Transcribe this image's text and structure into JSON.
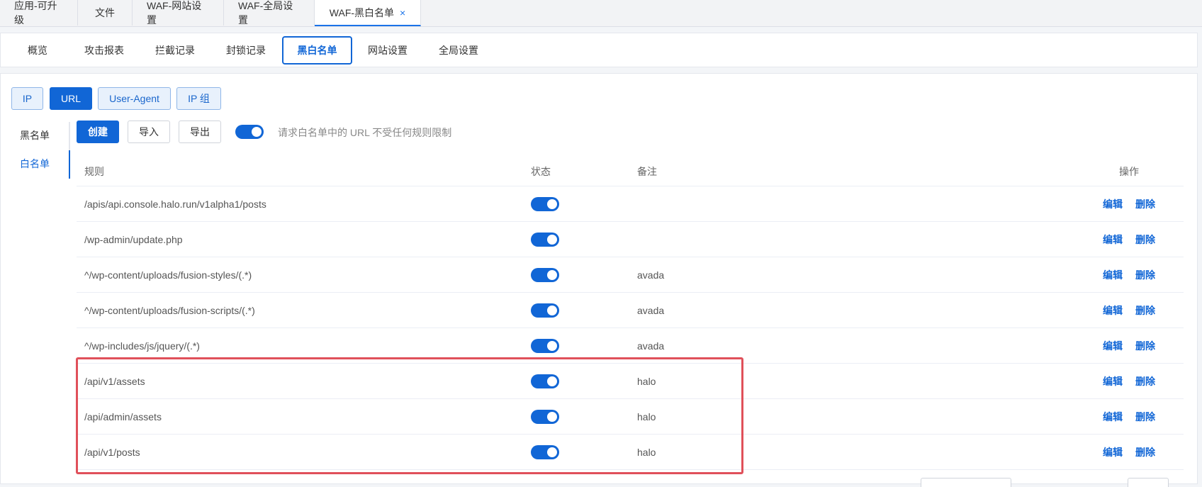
{
  "top_tabs": [
    {
      "label": "应用-可升级"
    },
    {
      "label": "文件"
    },
    {
      "label": "WAF-网站设置"
    },
    {
      "label": "WAF-全局设置"
    },
    {
      "label": "WAF-黑白名单",
      "close": "×"
    }
  ],
  "sub_tabs": [
    {
      "label": "概览"
    },
    {
      "label": "攻击报表"
    },
    {
      "label": "拦截记录"
    },
    {
      "label": "封锁记录"
    },
    {
      "label": "黑白名单"
    },
    {
      "label": "网站设置"
    },
    {
      "label": "全局设置"
    }
  ],
  "type_buttons": [
    {
      "label": "IP"
    },
    {
      "label": "URL"
    },
    {
      "label": "User-Agent"
    },
    {
      "label": "IP 组"
    }
  ],
  "side": {
    "blacklist": "黑名单",
    "whitelist": "白名单"
  },
  "toolbar": {
    "create": "创建",
    "import": "导入",
    "export": "导出",
    "hint": "请求白名单中的 URL 不受任何规则限制"
  },
  "table": {
    "headers": {
      "rule": "规则",
      "status": "状态",
      "note": "备注",
      "actions": "操作"
    },
    "rows": [
      {
        "rule": "/apis/api.console.halo.run/v1alpha1/posts",
        "note": "",
        "enabled": true,
        "edit": "编辑",
        "delete": "删除"
      },
      {
        "rule": "/wp-admin/update.php",
        "note": "",
        "enabled": true,
        "edit": "编辑",
        "delete": "删除"
      },
      {
        "rule": "^/wp-content/uploads/fusion-styles/(.*)",
        "note": "avada",
        "enabled": true,
        "edit": "编辑",
        "delete": "删除"
      },
      {
        "rule": "^/wp-content/uploads/fusion-scripts/(.*)",
        "note": "avada",
        "enabled": true,
        "edit": "编辑",
        "delete": "删除"
      },
      {
        "rule": "^/wp-includes/js/jquery/(.*)",
        "note": "avada",
        "enabled": true,
        "edit": "编辑",
        "delete": "删除"
      },
      {
        "rule": "/api/v1/assets",
        "note": "halo",
        "enabled": true,
        "edit": "编辑",
        "delete": "删除"
      },
      {
        "rule": "/api/admin/assets",
        "note": "halo",
        "enabled": true,
        "edit": "编辑",
        "delete": "删除"
      },
      {
        "rule": "/api/v1/posts",
        "note": "halo",
        "enabled": true,
        "edit": "编辑",
        "delete": "删除"
      }
    ]
  },
  "colors": {
    "accent": "#1166d6",
    "highlight": "#e0505a"
  }
}
